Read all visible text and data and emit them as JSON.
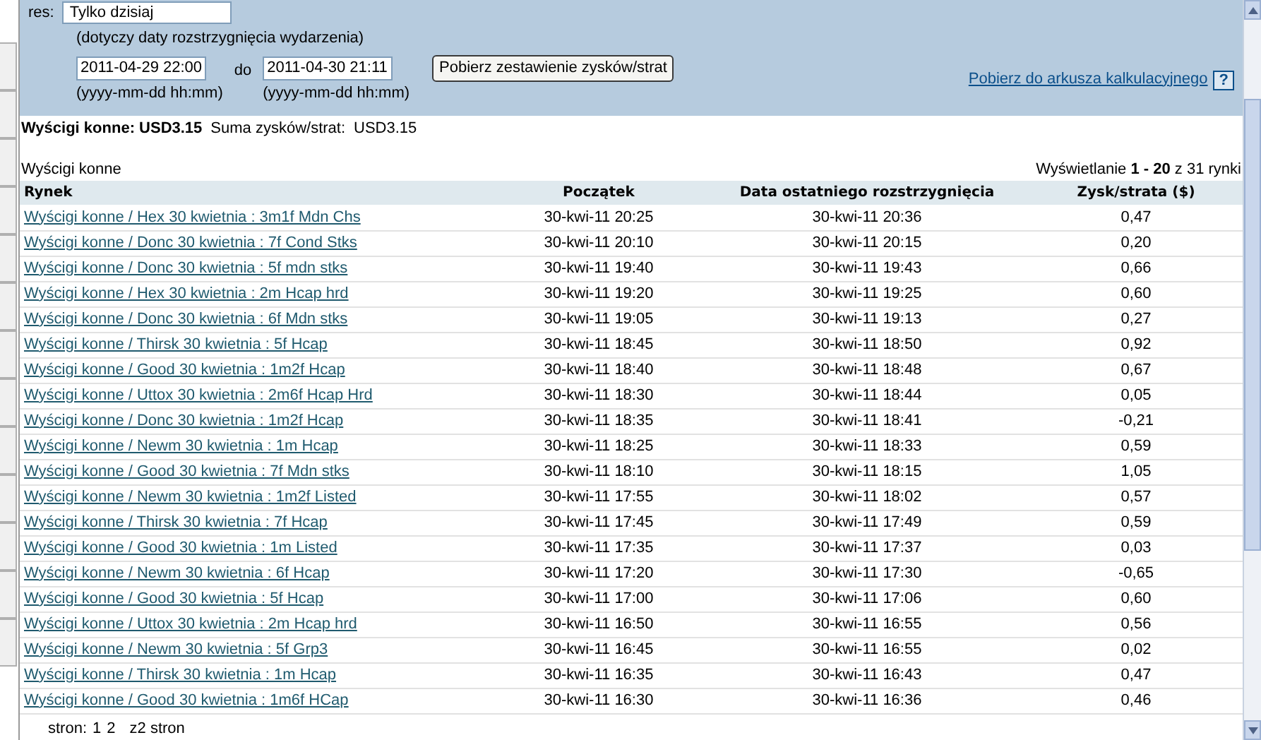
{
  "filter": {
    "label": "res:",
    "select_value": "Tylko dzisiaj",
    "note": "(dotyczy daty rozstrzygnięcia wydarzenia)",
    "from": "2011-04-29 22:00",
    "to_label": "do",
    "to": "2011-04-30 21:11",
    "from_hint": "(yyyy-mm-dd hh:mm)",
    "to_hint": "(yyyy-mm-dd hh:mm)",
    "submit": "Pobierz zestawienie zysków/strat",
    "export_link": "Pobierz do arkusza kalkulacyjnego",
    "help": "?"
  },
  "summary": {
    "title": "Wyścigi konne: USD3.15",
    "total_label": "Suma zysków/strat:",
    "total": "USD3.15"
  },
  "table": {
    "caption": "Wyścigi konne",
    "range": "Wyświetlanie **1 - 20** z 31 rynki",
    "columns": [
      "Rynek",
      "Początek",
      "Data ostatniego rozstrzygnięcia",
      "Zysk/strata ($)"
    ],
    "rows": [
      [
        "Wyścigi konne / Hex 30 kwietnia : 3m1f Mdn Chs",
        "30-kwi-11 20:25",
        "30-kwi-11 20:36",
        "0,47"
      ],
      [
        "Wyścigi konne / Donc 30 kwietnia : 7f Cond Stks",
        "30-kwi-11 20:10",
        "30-kwi-11 20:15",
        "0,20"
      ],
      [
        "Wyścigi konne / Donc 30 kwietnia : 5f mdn stks",
        "30-kwi-11 19:40",
        "30-kwi-11 19:43",
        "0,66"
      ],
      [
        "Wyścigi konne / Hex 30 kwietnia : 2m Hcap hrd",
        "30-kwi-11 19:20",
        "30-kwi-11 19:25",
        "0,60"
      ],
      [
        "Wyścigi konne / Donc 30 kwietnia : 6f Mdn stks",
        "30-kwi-11 19:05",
        "30-kwi-11 19:13",
        "0,27"
      ],
      [
        "Wyścigi konne / Thirsk 30 kwietnia : 5f Hcap",
        "30-kwi-11 18:45",
        "30-kwi-11 18:50",
        "0,92"
      ],
      [
        "Wyścigi konne / Good 30 kwietnia : 1m2f Hcap",
        "30-kwi-11 18:40",
        "30-kwi-11 18:48",
        "0,67"
      ],
      [
        "Wyścigi konne / Uttox 30 kwietnia : 2m6f Hcap Hrd",
        "30-kwi-11 18:30",
        "30-kwi-11 18:44",
        "0,05"
      ],
      [
        "Wyścigi konne / Donc 30 kwietnia : 1m2f Hcap",
        "30-kwi-11 18:35",
        "30-kwi-11 18:41",
        "-0,21"
      ],
      [
        "Wyścigi konne / Newm 30 kwietnia : 1m Hcap",
        "30-kwi-11 18:25",
        "30-kwi-11 18:33",
        "0,59"
      ],
      [
        "Wyścigi konne / Good 30 kwietnia : 7f Mdn stks",
        "30-kwi-11 18:10",
        "30-kwi-11 18:15",
        "1,05"
      ],
      [
        "Wyścigi konne / Newm 30 kwietnia : 1m2f Listed",
        "30-kwi-11 17:55",
        "30-kwi-11 18:02",
        "0,57"
      ],
      [
        "Wyścigi konne / Thirsk 30 kwietnia : 7f Hcap",
        "30-kwi-11 17:45",
        "30-kwi-11 17:49",
        "0,59"
      ],
      [
        "Wyścigi konne / Good 30 kwietnia : 1m Listed",
        "30-kwi-11 17:35",
        "30-kwi-11 17:37",
        "0,03"
      ],
      [
        "Wyścigi konne / Newm 30 kwietnia : 6f Hcap",
        "30-kwi-11 17:20",
        "30-kwi-11 17:30",
        "-0,65"
      ],
      [
        "Wyścigi konne / Good 30 kwietnia : 5f Hcap",
        "30-kwi-11 17:00",
        "30-kwi-11 17:06",
        "0,60"
      ],
      [
        "Wyścigi konne / Uttox 30 kwietnia : 2m Hcap hrd",
        "30-kwi-11 16:50",
        "30-kwi-11 16:55",
        "0,56"
      ],
      [
        "Wyścigi konne / Newm 30 kwietnia : 5f Grp3",
        "30-kwi-11 16:45",
        "30-kwi-11 16:55",
        "0,02"
      ],
      [
        "Wyścigi konne / Thirsk 30 kwietnia : 1m Hcap",
        "30-kwi-11 16:35",
        "30-kwi-11 16:43",
        "0,47"
      ],
      [
        "Wyścigi konne / Good 30 kwietnia : 1m6f HCap",
        "30-kwi-11 16:30",
        "30-kwi-11 16:36",
        "0,46"
      ]
    ]
  },
  "pagination": {
    "label": "stron:",
    "pages": [
      "1",
      "2"
    ],
    "total": "z2 stron"
  }
}
